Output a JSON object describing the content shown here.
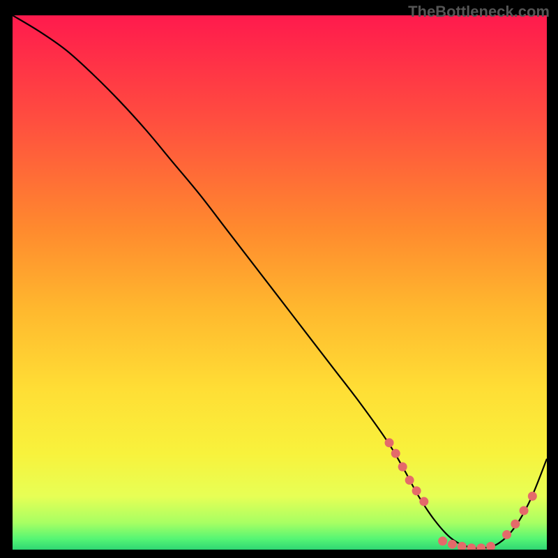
{
  "watermark": "TheBottleneck.com",
  "chart_data": {
    "type": "line",
    "title": "",
    "xlabel": "",
    "ylabel": "",
    "xlim": [
      0,
      100
    ],
    "ylim": [
      0,
      100
    ],
    "grid": false,
    "series": [
      {
        "name": "curve",
        "color": "#000000",
        "x": [
          0,
          5,
          10,
          15,
          20,
          25,
          30,
          35,
          40,
          45,
          50,
          55,
          60,
          65,
          70,
          73,
          76,
          79,
          82,
          85,
          88,
          91,
          94,
          97,
          100
        ],
        "y": [
          100,
          97,
          93.5,
          89,
          84,
          78.5,
          72.5,
          66.5,
          60,
          53.5,
          47,
          40.5,
          34,
          27.5,
          20.5,
          15.5,
          10,
          5.5,
          2.2,
          0.6,
          0.3,
          1.2,
          4.2,
          9.5,
          17
        ]
      },
      {
        "name": "markers-left",
        "color": "#e46a6a",
        "type": "scatter",
        "x": [
          70.5,
          71.7,
          73.0,
          74.3,
          75.6,
          77.0
        ],
        "y": [
          20.0,
          18.0,
          15.5,
          13.0,
          11.0,
          9.0
        ]
      },
      {
        "name": "markers-bottom",
        "color": "#e46a6a",
        "type": "scatter",
        "x": [
          80.5,
          82.3,
          84.1,
          85.9,
          87.7,
          89.5
        ],
        "y": [
          1.6,
          1.0,
          0.6,
          0.3,
          0.3,
          0.6
        ]
      },
      {
        "name": "markers-right",
        "color": "#e46a6a",
        "type": "scatter",
        "x": [
          92.5,
          94.1,
          95.7,
          97.3
        ],
        "y": [
          2.8,
          4.8,
          7.3,
          10.0
        ]
      }
    ],
    "background": {
      "type": "gradient",
      "stops": [
        {
          "offset": 0.0,
          "color": "#ff1a4d"
        },
        {
          "offset": 0.2,
          "color": "#ff4f3f"
        },
        {
          "offset": 0.4,
          "color": "#ff8a2e"
        },
        {
          "offset": 0.55,
          "color": "#ffb82e"
        },
        {
          "offset": 0.7,
          "color": "#ffde35"
        },
        {
          "offset": 0.82,
          "color": "#f8f23c"
        },
        {
          "offset": 0.9,
          "color": "#e7ff55"
        },
        {
          "offset": 0.95,
          "color": "#a7ff63"
        },
        {
          "offset": 0.98,
          "color": "#55f574"
        },
        {
          "offset": 1.0,
          "color": "#2fd673"
        }
      ]
    }
  }
}
